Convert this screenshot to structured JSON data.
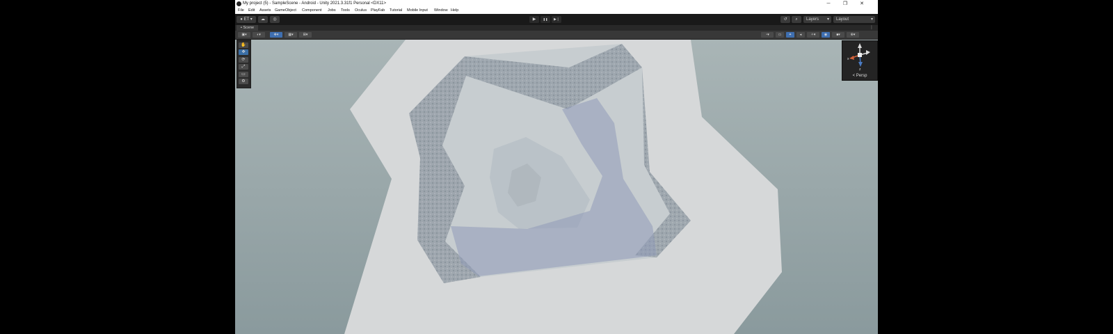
{
  "window": {
    "title": "My project (5) - SampleScene - Android - Unity 2021.3.31f1 Personal <DX11>",
    "controls": {
      "minimize": "─",
      "maximize": "❐",
      "close": "✕"
    }
  },
  "menu": [
    "File",
    "Edit",
    "Assets",
    "GameObject",
    "Component",
    "Jobs",
    "Tools",
    "Oculus",
    "PlayFab",
    "Tutorial",
    "Mobile Input",
    "Window",
    "Help"
  ],
  "toolbar": {
    "account_label": "ET",
    "play_icon": "▶",
    "pause_icon": "❚❚",
    "step_icon": "▶❘",
    "layers_label": "Layers",
    "layout_label": "Layout",
    "history_icon": "↺",
    "search_icon": "⌕"
  },
  "scene_tab": {
    "label": "Scene",
    "more": "⋮"
  },
  "tools": [
    "✋",
    "✥",
    "⟳",
    "⤢",
    "▭",
    "⚙"
  ],
  "gizmo": {
    "axis_x": "x",
    "axis_z": "z",
    "persp_label": "< Persp"
  },
  "colors": {
    "viewport_sky": "#8e9ea0",
    "terrain": "#d6d8d9",
    "inner_floor": "#c7cdd0",
    "wall": "#9aa3ab",
    "shadow": "#8f9bb8",
    "accent": "#3f6fb0"
  }
}
